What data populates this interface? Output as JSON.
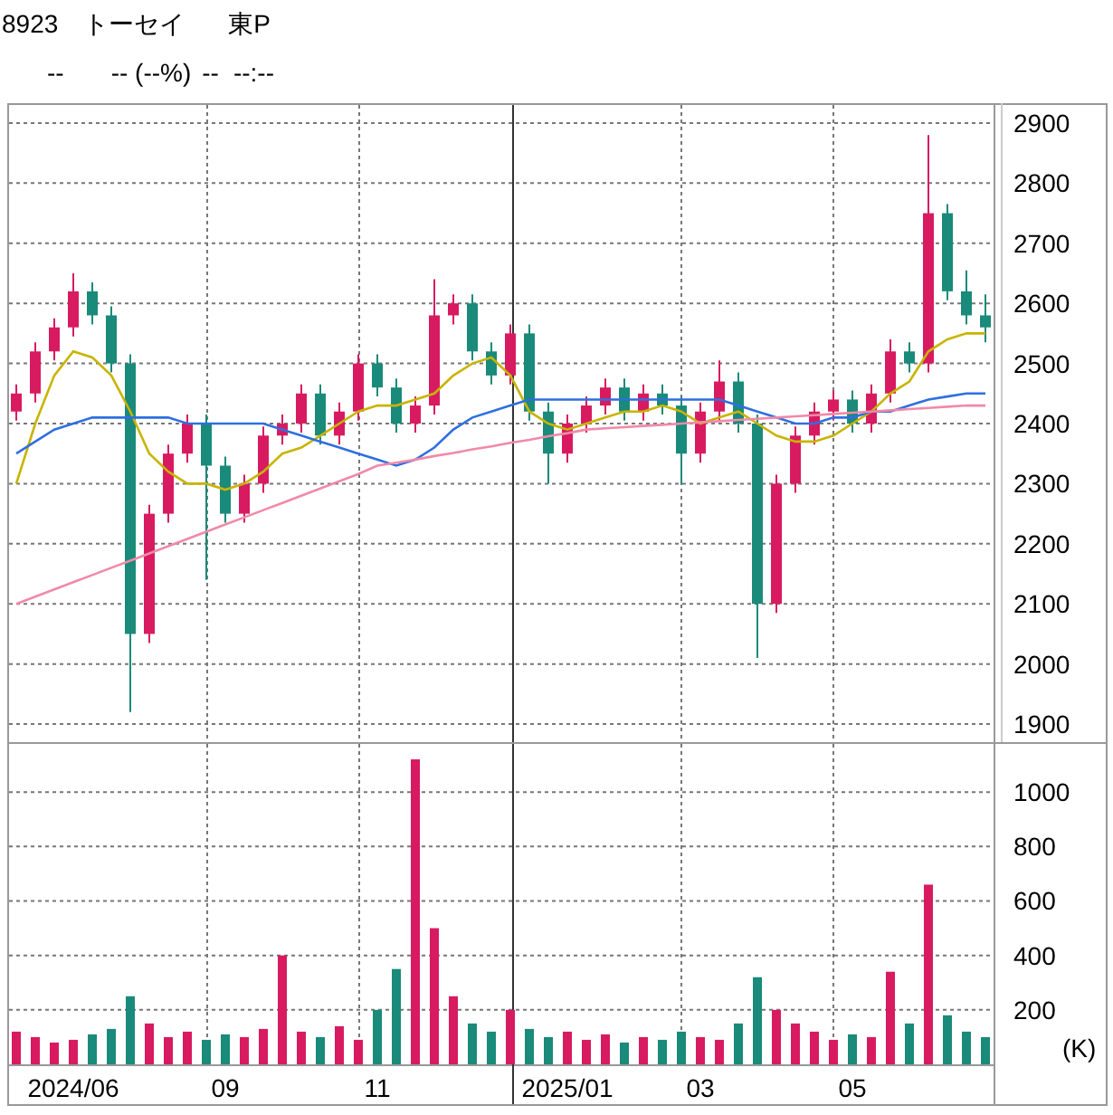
{
  "header": {
    "code": "8923",
    "name": "トーセイ",
    "market": "東P"
  },
  "quote": {
    "price": "--",
    "change": "-- (--%)",
    "value_3": "--",
    "time": "--:--"
  },
  "price_chart": {
    "chart_data": {
      "type": "candlestick",
      "grid": true,
      "ylim": [
        1870,
        2930
      ],
      "yticks": [
        1900,
        2000,
        2100,
        2200,
        2300,
        2400,
        2500,
        2600,
        2700,
        2800,
        2900
      ],
      "ohlc": [
        [
          2420,
          2465,
          2405,
          2450
        ],
        [
          2450,
          2535,
          2435,
          2520
        ],
        [
          2520,
          2575,
          2505,
          2560
        ],
        [
          2560,
          2650,
          2545,
          2620
        ],
        [
          2620,
          2635,
          2565,
          2580
        ],
        [
          2580,
          2595,
          2485,
          2500
        ],
        [
          2500,
          2515,
          1920,
          2050
        ],
        [
          2050,
          2265,
          2035,
          2250
        ],
        [
          2250,
          2365,
          2235,
          2350
        ],
        [
          2350,
          2415,
          2335,
          2400
        ],
        [
          2400,
          2415,
          2140,
          2330
        ],
        [
          2330,
          2345,
          2235,
          2250
        ],
        [
          2250,
          2315,
          2235,
          2300
        ],
        [
          2300,
          2395,
          2285,
          2380
        ],
        [
          2380,
          2415,
          2365,
          2400
        ],
        [
          2400,
          2465,
          2385,
          2450
        ],
        [
          2450,
          2465,
          2365,
          2380
        ],
        [
          2380,
          2435,
          2365,
          2420
        ],
        [
          2420,
          2515,
          2405,
          2500
        ],
        [
          2500,
          2515,
          2445,
          2460
        ],
        [
          2460,
          2475,
          2385,
          2400
        ],
        [
          2400,
          2445,
          2385,
          2430
        ],
        [
          2430,
          2640,
          2415,
          2580
        ],
        [
          2580,
          2615,
          2565,
          2600
        ],
        [
          2600,
          2615,
          2505,
          2520
        ],
        [
          2520,
          2535,
          2465,
          2480
        ],
        [
          2480,
          2565,
          2465,
          2550
        ],
        [
          2550,
          2565,
          2405,
          2420
        ],
        [
          2420,
          2435,
          2300,
          2350
        ],
        [
          2350,
          2415,
          2335,
          2400
        ],
        [
          2400,
          2445,
          2385,
          2430
        ],
        [
          2430,
          2475,
          2415,
          2460
        ],
        [
          2460,
          2475,
          2405,
          2420
        ],
        [
          2420,
          2465,
          2405,
          2450
        ],
        [
          2450,
          2465,
          2415,
          2430
        ],
        [
          2430,
          2445,
          2300,
          2350
        ],
        [
          2350,
          2435,
          2335,
          2420
        ],
        [
          2420,
          2505,
          2405,
          2470
        ],
        [
          2470,
          2485,
          2385,
          2400
        ],
        [
          2400,
          2415,
          2010,
          2100
        ],
        [
          2100,
          2315,
          2085,
          2300
        ],
        [
          2300,
          2395,
          2285,
          2380
        ],
        [
          2380,
          2435,
          2365,
          2420
        ],
        [
          2420,
          2455,
          2405,
          2440
        ],
        [
          2440,
          2455,
          2385,
          2400
        ],
        [
          2400,
          2465,
          2385,
          2450
        ],
        [
          2450,
          2540,
          2435,
          2520
        ],
        [
          2520,
          2535,
          2485,
          2500
        ],
        [
          2500,
          2880,
          2485,
          2750
        ],
        [
          2750,
          2765,
          2605,
          2620
        ],
        [
          2620,
          2655,
          2565,
          2580
        ],
        [
          2580,
          2615,
          2535,
          2560
        ]
      ],
      "series": [
        {
          "type": "line",
          "color": "#c8b400",
          "values": [
            2300,
            2400,
            2480,
            2520,
            2510,
            2480,
            2420,
            2350,
            2320,
            2300,
            2300,
            2290,
            2300,
            2320,
            2350,
            2360,
            2380,
            2400,
            2420,
            2430,
            2430,
            2440,
            2450,
            2480,
            2500,
            2510,
            2480,
            2420,
            2400,
            2390,
            2400,
            2410,
            2420,
            2420,
            2430,
            2420,
            2400,
            2410,
            2420,
            2400,
            2380,
            2370,
            2370,
            2380,
            2400,
            2420,
            2450,
            2470,
            2520,
            2540,
            2550,
            2550
          ]
        },
        {
          "type": "line",
          "color": "#2f6fe0",
          "values": [
            2350,
            2370,
            2390,
            2400,
            2410,
            2410,
            2410,
            2410,
            2410,
            2400,
            2400,
            2400,
            2400,
            2400,
            2390,
            2380,
            2370,
            2360,
            2350,
            2340,
            2330,
            2340,
            2360,
            2390,
            2410,
            2420,
            2430,
            2440,
            2440,
            2440,
            2440,
            2440,
            2440,
            2440,
            2440,
            2440,
            2440,
            2440,
            2430,
            2420,
            2410,
            2400,
            2400,
            2410,
            2410,
            2420,
            2420,
            2430,
            2440,
            2445,
            2450,
            2450
          ]
        },
        {
          "type": "line",
          "color": "#f08aa8",
          "values": [
            2100,
            2112,
            2124,
            2136,
            2148,
            2160,
            2172,
            2184,
            2196,
            2208,
            2220,
            2232,
            2244,
            2256,
            2268,
            2280,
            2292,
            2304,
            2316,
            2330,
            2335,
            2340,
            2346,
            2351,
            2357,
            2362,
            2368,
            2373,
            2379,
            2384,
            2390,
            2392,
            2394,
            2396,
            2398,
            2400,
            2402,
            2404,
            2406,
            2408,
            2410,
            2412,
            2414,
            2416,
            2418,
            2420,
            2422,
            2424,
            2426,
            2428,
            2430,
            2430
          ]
        }
      ]
    }
  },
  "volume_chart": {
    "chart_data": {
      "type": "bar",
      "grid": true,
      "ylabel": "(K)",
      "ylim": [
        0,
        1170
      ],
      "yticks": [
        200,
        400,
        600,
        800,
        1000
      ],
      "categories": [
        null,
        null,
        null,
        "2024/06",
        null,
        null,
        null,
        null,
        null,
        null,
        null,
        "09",
        null,
        null,
        null,
        null,
        null,
        null,
        null,
        "11",
        null,
        null,
        null,
        null,
        null,
        null,
        null,
        null,
        null,
        "2025/01",
        null,
        null,
        null,
        null,
        null,
        null,
        "03",
        null,
        null,
        null,
        null,
        null,
        null,
        null,
        "05",
        null,
        null,
        null,
        null,
        null,
        null,
        null
      ],
      "values": [
        120,
        100,
        80,
        90,
        110,
        130,
        250,
        150,
        100,
        120,
        90,
        110,
        100,
        130,
        400,
        120,
        100,
        140,
        90,
        200,
        350,
        1120,
        500,
        250,
        150,
        120,
        200,
        130,
        100,
        120,
        90,
        110,
        80,
        100,
        90,
        120,
        100,
        90,
        150,
        320,
        200,
        150,
        120,
        90,
        110,
        100,
        340,
        150,
        660,
        180,
        120,
        100
      ]
    }
  }
}
